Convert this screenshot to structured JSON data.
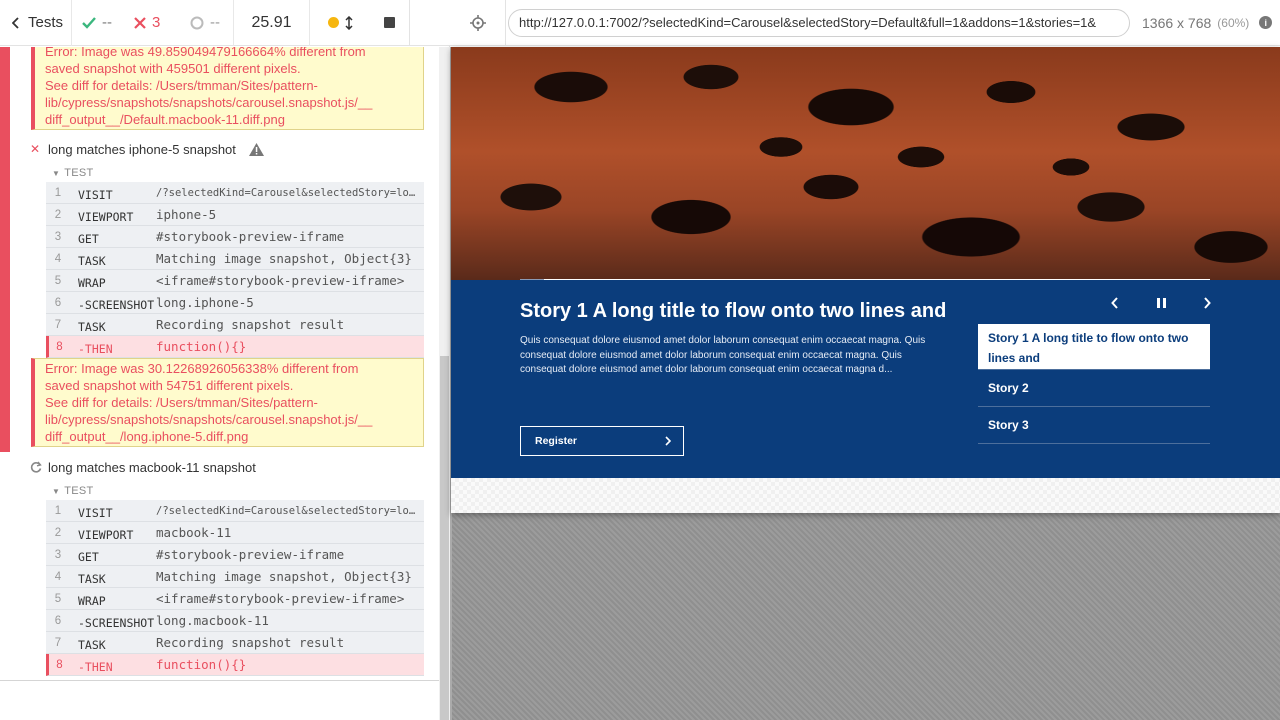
{
  "stats": {
    "tests_label": "Tests",
    "passed": "--",
    "failed": "3",
    "pending": "--",
    "duration": "25.91"
  },
  "errors": {
    "first": {
      "lines": [
        "Error: Image was 49.859049479166664% different from",
        "saved snapshot with 459501 different pixels.",
        "See diff for details: /Users/tmman/Sites/pattern-",
        "lib/cypress/snapshots/snapshots/carousel.snapshot.js/__",
        "diff_output__/Default.macbook-11.diff.png"
      ]
    },
    "second": {
      "lines": [
        "Error: Image was 30.12268926056338% different from",
        "saved snapshot with 54751 different pixels.",
        "See diff for details: /Users/tmman/Sites/pattern-",
        "lib/cypress/snapshots/snapshots/carousel.snapshot.js/__",
        "diff_output__/long.iphone-5.diff.png"
      ]
    }
  },
  "tests": [
    {
      "title": "long matches iphone-5 snapshot",
      "state": "failed",
      "header": "TEST",
      "commands": [
        {
          "num": "1",
          "name": "VISIT",
          "msg": "/?selectedKind=Carousel&selectedStory=lon…",
          "small": true
        },
        {
          "num": "2",
          "name": "VIEWPORT",
          "msg": "iphone-5"
        },
        {
          "num": "3",
          "name": "GET",
          "msg": "#storybook-preview-iframe"
        },
        {
          "num": "4",
          "name": "TASK",
          "msg": "Matching image snapshot, Object{3}"
        },
        {
          "num": "5",
          "name": "WRAP",
          "msg": "<iframe#storybook-preview-iframe>"
        },
        {
          "num": "6",
          "name": "-SCREENSHOT",
          "msg": "long.iphone-5"
        },
        {
          "num": "7",
          "name": "TASK",
          "msg": "Recording snapshot result"
        },
        {
          "num": "8",
          "name": "-THEN",
          "msg": "function(){}",
          "failed": true
        }
      ]
    },
    {
      "title": "long matches macbook-11 snapshot",
      "state": "running",
      "header": "TEST",
      "commands": [
        {
          "num": "1",
          "name": "VISIT",
          "msg": "/?selectedKind=Carousel&selectedStory=lon…",
          "small": true
        },
        {
          "num": "2",
          "name": "VIEWPORT",
          "msg": "macbook-11"
        },
        {
          "num": "3",
          "name": "GET",
          "msg": "#storybook-preview-iframe"
        },
        {
          "num": "4",
          "name": "TASK",
          "msg": "Matching image snapshot, Object{3}"
        },
        {
          "num": "5",
          "name": "WRAP",
          "msg": "<iframe#storybook-preview-iframe>"
        },
        {
          "num": "6",
          "name": "-SCREENSHOT",
          "msg": "long.macbook-11"
        },
        {
          "num": "7",
          "name": "TASK",
          "msg": "Recording snapshot result"
        },
        {
          "num": "8",
          "name": "-THEN",
          "msg": "function(){}",
          "failed": true
        }
      ]
    }
  ],
  "aut": {
    "url": "http://127.0.0.1:7002/?selectedKind=Carousel&selectedStory=Default&full=1&addons=1&stories=1&",
    "viewport": "1366 x 768",
    "scale": "(60%)"
  },
  "carousel": {
    "title": "Story 1 A long title to flow onto two lines and",
    "description": "Quis consequat dolore eiusmod amet dolor laborum consequat enim occaecat magna. Quis consequat dolore eiusmod amet dolor laborum consequat enim occaecat magna. Quis consequat dolore eiusmod amet dolor laborum consequat enim occaecat magna d...",
    "register_label": "Register",
    "progress": 0.035,
    "stories": [
      {
        "label": "Story 1 A long title to flow onto two lines and",
        "active": true
      },
      {
        "label": "Story 2",
        "active": false
      },
      {
        "label": "Story 3",
        "active": false
      }
    ],
    "colors": {
      "panel": "#0b3d7c",
      "progress": "#8a9ab5"
    }
  },
  "colors": {
    "fail": "#e94f5f",
    "pass": "#3bb77e",
    "running": "#f6b60f",
    "error_bg": "#fffbcd"
  }
}
